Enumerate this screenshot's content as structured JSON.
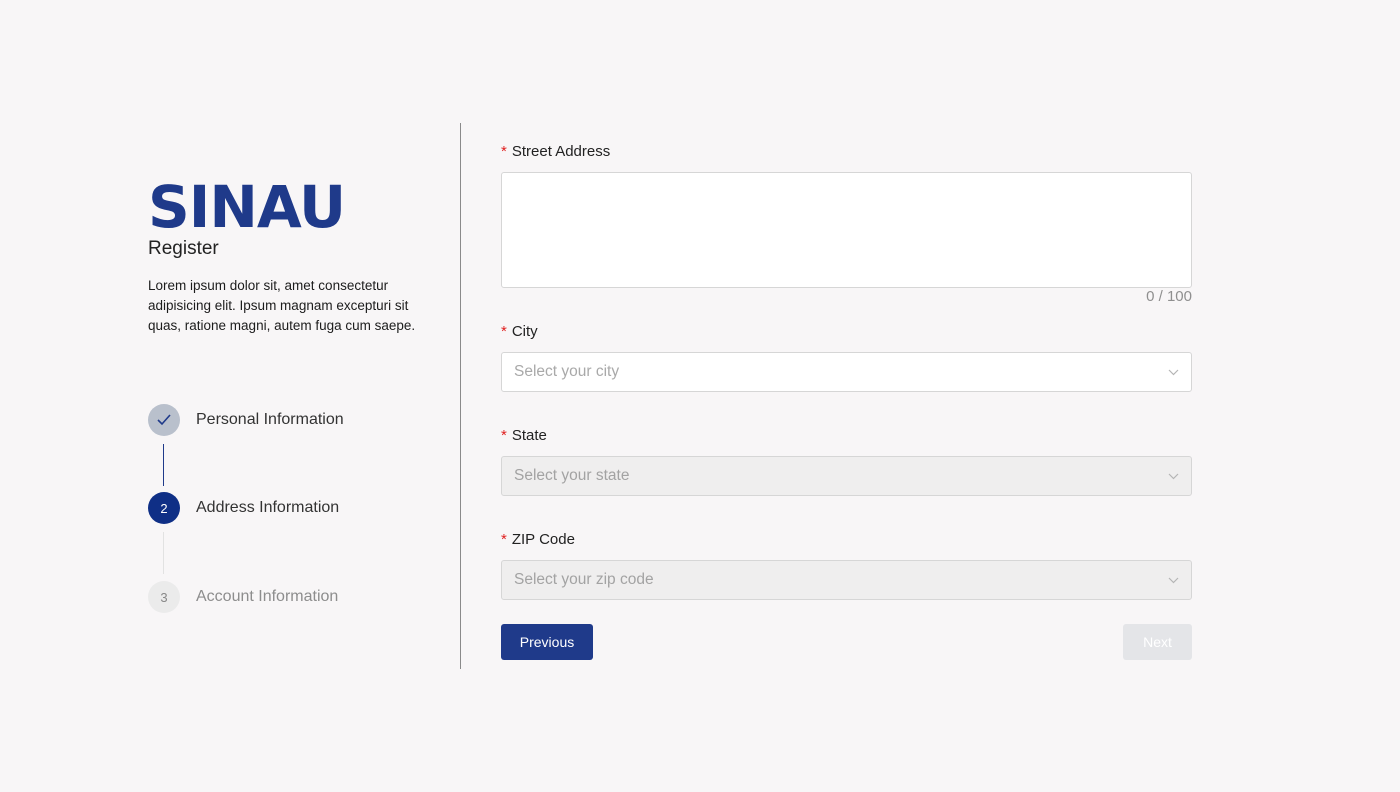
{
  "brand": {
    "logo": "SINAU",
    "subtitle": "Register",
    "description": "Lorem ipsum dolor sit, amet consectetur adipisicing elit. Ipsum magnam excepturi sit quas, ratione magni, autem fuga cum saepe."
  },
  "steps": [
    {
      "number": "1",
      "label": "Personal Information",
      "status": "completed"
    },
    {
      "number": "2",
      "label": "Address Information",
      "status": "active"
    },
    {
      "number": "3",
      "label": "Account Information",
      "status": "pending"
    }
  ],
  "form": {
    "required_mark": "*",
    "street": {
      "label": "Street Address",
      "value": "",
      "counter": "0 / 100"
    },
    "city": {
      "label": "City",
      "placeholder": "Select your city"
    },
    "state": {
      "label": "State",
      "placeholder": "Select your state"
    },
    "zip": {
      "label": "ZIP Code",
      "placeholder": "Select your zip code"
    }
  },
  "buttons": {
    "previous": "Previous",
    "next": "Next"
  },
  "colors": {
    "primary": "#1f3a8a",
    "required": "#e02020",
    "background": "#f8f6f7"
  }
}
